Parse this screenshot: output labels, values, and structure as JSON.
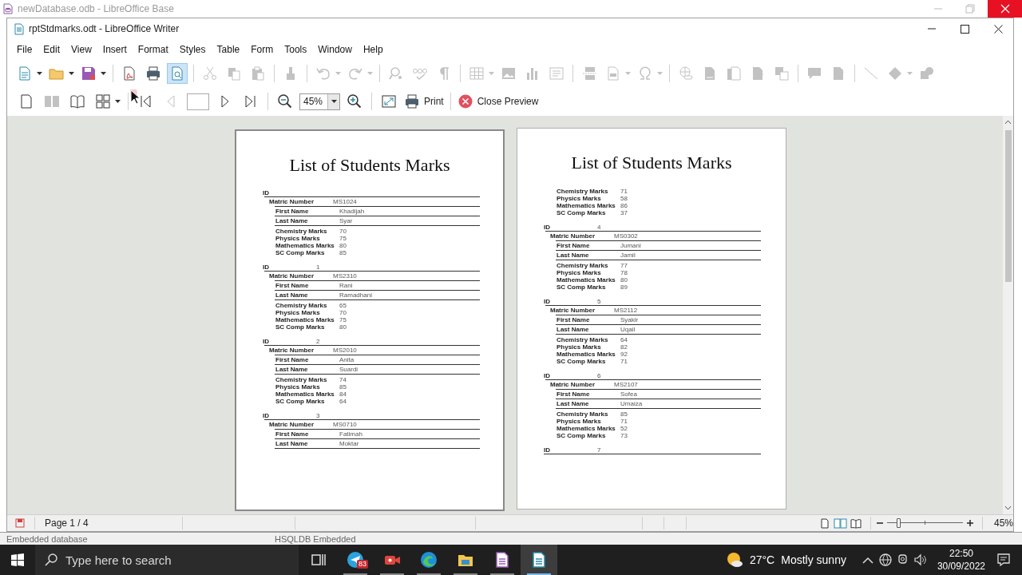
{
  "base_window": {
    "title": "newDatabase.odb - LibreOffice Base",
    "status_left": "Embedded database",
    "status_right": "HSQLDB Embedded"
  },
  "writer_window": {
    "title": "rptStdmarks.odt - LibreOffice Writer"
  },
  "menu": [
    "File",
    "Edit",
    "View",
    "Insert",
    "Format",
    "Styles",
    "Table",
    "Form",
    "Tools",
    "Window",
    "Help"
  ],
  "standard_toolbar": [
    {
      "kind": "new",
      "disabled": false,
      "dropdown": true,
      "selected": false
    },
    {
      "kind": "open",
      "disabled": false,
      "dropdown": true,
      "selected": false
    },
    {
      "kind": "save",
      "disabled": false,
      "dropdown": true,
      "selected": false
    },
    {
      "kind": "separator"
    },
    {
      "kind": "pdf",
      "disabled": false,
      "dropdown": false,
      "selected": false
    },
    {
      "kind": "print",
      "disabled": false,
      "dropdown": false,
      "selected": false
    },
    {
      "kind": "preview",
      "disabled": false,
      "dropdown": false,
      "selected": true
    },
    {
      "kind": "separator"
    },
    {
      "kind": "cut",
      "disabled": true,
      "dropdown": false,
      "selected": false
    },
    {
      "kind": "copy",
      "disabled": true,
      "dropdown": false,
      "selected": false
    },
    {
      "kind": "paste",
      "disabled": true,
      "dropdown": false,
      "selected": false
    },
    {
      "kind": "separator"
    },
    {
      "kind": "clone",
      "disabled": true,
      "dropdown": false,
      "selected": false
    },
    {
      "kind": "separator"
    },
    {
      "kind": "undo",
      "disabled": true,
      "dropdown": true,
      "selected": false
    },
    {
      "kind": "redo",
      "disabled": true,
      "dropdown": true,
      "selected": false
    },
    {
      "kind": "separator"
    },
    {
      "kind": "find",
      "disabled": true,
      "dropdown": false,
      "selected": false
    },
    {
      "kind": "spell",
      "disabled": true,
      "dropdown": false,
      "selected": false
    },
    {
      "kind": "pilcrow",
      "disabled": true,
      "dropdown": false,
      "selected": false
    },
    {
      "kind": "separator"
    },
    {
      "kind": "table",
      "disabled": true,
      "dropdown": true,
      "selected": false
    },
    {
      "kind": "image",
      "disabled": true,
      "dropdown": false,
      "selected": false
    },
    {
      "kind": "chart",
      "disabled": true,
      "dropdown": false,
      "selected": false
    },
    {
      "kind": "textbox",
      "disabled": true,
      "dropdown": false,
      "selected": false
    },
    {
      "kind": "separator"
    },
    {
      "kind": "pagebreak",
      "disabled": true,
      "dropdown": false,
      "selected": false
    },
    {
      "kind": "field",
      "disabled": true,
      "dropdown": true,
      "selected": false
    },
    {
      "kind": "omega",
      "disabled": true,
      "dropdown": true,
      "selected": false
    },
    {
      "kind": "separator"
    },
    {
      "kind": "hyperlink",
      "disabled": true,
      "dropdown": false,
      "selected": false
    },
    {
      "kind": "footnote",
      "disabled": true,
      "dropdown": false,
      "selected": false
    },
    {
      "kind": "endnote",
      "disabled": true,
      "dropdown": false,
      "selected": false
    },
    {
      "kind": "bookmark",
      "disabled": true,
      "dropdown": false,
      "selected": false
    },
    {
      "kind": "crossref",
      "disabled": true,
      "dropdown": false,
      "selected": false
    },
    {
      "kind": "separator"
    },
    {
      "kind": "comment",
      "disabled": true,
      "dropdown": false,
      "selected": false
    },
    {
      "kind": "track",
      "disabled": true,
      "dropdown": false,
      "selected": false
    },
    {
      "kind": "separator"
    },
    {
      "kind": "line",
      "disabled": true,
      "dropdown": false,
      "selected": false
    },
    {
      "kind": "diamond",
      "disabled": true,
      "dropdown": true,
      "selected": false
    },
    {
      "kind": "shapes",
      "disabled": true,
      "dropdown": false,
      "selected": false
    }
  ],
  "preview_toolbar": [
    {
      "kind": "single_page",
      "disabled": false,
      "dropdown": false
    },
    {
      "kind": "two_pages",
      "disabled": true,
      "dropdown": false
    },
    {
      "kind": "book",
      "disabled": false,
      "dropdown": false
    },
    {
      "kind": "multi",
      "disabled": false,
      "dropdown": true
    },
    {
      "kind": "separator"
    },
    {
      "kind": "first_page",
      "disabled": false,
      "dropdown": false
    },
    {
      "kind": "previous",
      "disabled": true,
      "dropdown": false
    },
    {
      "kind": "page_field",
      "disabled": false,
      "dropdown": false
    },
    {
      "kind": "next",
      "disabled": false,
      "dropdown": false
    },
    {
      "kind": "last_page",
      "disabled": false,
      "dropdown": false
    },
    {
      "kind": "separator"
    },
    {
      "kind": "zoom_out",
      "disabled": false,
      "dropdown": false
    },
    {
      "kind": "zoom_box",
      "disabled": false,
      "dropdown": true,
      "value": "45%"
    },
    {
      "kind": "zoom_in",
      "disabled": false,
      "dropdown": false
    },
    {
      "kind": "separator"
    },
    {
      "kind": "fullscreen",
      "disabled": false,
      "dropdown": false
    },
    {
      "kind": "print",
      "disabled": false,
      "dropdown": false,
      "label": "Print"
    },
    {
      "kind": "separator"
    },
    {
      "kind": "close_preview",
      "disabled": false,
      "dropdown": false,
      "label": "Close Preview"
    }
  ],
  "pages": [
    {
      "title": "List of Students Marks",
      "records": [
        {
          "id_label": "ID",
          "matric_label": "Matric Number",
          "matric": "MS1024",
          "first_label": "First Name",
          "first": "Khadijah",
          "last_label": "Last Name",
          "last": "Syar",
          "marks": [
            {
              "label": "Chemistry Marks",
              "value": "70"
            },
            {
              "label": "Physics Marks",
              "value": "75"
            },
            {
              "label": "Mathematics Marks",
              "value": "80"
            },
            {
              "label": "SC Comp Marks",
              "value": "85"
            }
          ]
        },
        {
          "id_label": "ID",
          "id": "1",
          "matric_label": "Matric Number",
          "matric": "MS2310",
          "first_label": "First Name",
          "first": "Rani",
          "last_label": "Last Name",
          "last": "Ramadhani",
          "marks": [
            {
              "label": "Chemistry Marks",
              "value": "65"
            },
            {
              "label": "Physics Marks",
              "value": "70"
            },
            {
              "label": "Mathematics Marks",
              "value": "75"
            },
            {
              "label": "SC Comp Marks",
              "value": "80"
            }
          ]
        },
        {
          "id_label": "ID",
          "id": "2",
          "matric_label": "Matric Number",
          "matric": "MS2010",
          "first_label": "First Name",
          "first": "Anita",
          "last_label": "Last Name",
          "last": "Suardi",
          "marks": [
            {
              "label": "Chemistry Marks",
              "value": "74"
            },
            {
              "label": "Physics Marks",
              "value": "85"
            },
            {
              "label": "Mathematics Marks",
              "value": "84"
            },
            {
              "label": "SC Comp Marks",
              "value": "64"
            }
          ]
        },
        {
          "id_label": "ID",
          "id": "3",
          "matric_label": "Matric Number",
          "matric": "MS0710",
          "first_label": "First Name",
          "first": "Fatimah",
          "last_label": "Last Name",
          "last": "Moktar"
        }
      ]
    },
    {
      "title": "List of Students Marks",
      "records": [
        {
          "marks": [
            {
              "label": "Chemistry Marks",
              "value": "71"
            },
            {
              "label": "Physics Marks",
              "value": "58"
            },
            {
              "label": "Mathematics Marks",
              "value": "86"
            },
            {
              "label": "SC Comp Marks",
              "value": "37"
            }
          ]
        },
        {
          "id_label": "ID",
          "id": "4",
          "matric_label": "Matric Number",
          "matric": "MS0302",
          "first_label": "First Name",
          "first": "Jumani",
          "last_label": "Last Name",
          "last": "Jamil",
          "marks": [
            {
              "label": "Chemistry Marks",
              "value": "77"
            },
            {
              "label": "Physics Marks",
              "value": "78"
            },
            {
              "label": "Mathematics Marks",
              "value": "80"
            },
            {
              "label": "SC Comp Marks",
              "value": "89"
            }
          ]
        },
        {
          "id_label": "ID",
          "id": "5",
          "matric_label": "Matric Number",
          "matric": "MS2112",
          "first_label": "First Name",
          "first": "Syakir",
          "last_label": "Last Name",
          "last": "Uqail",
          "marks": [
            {
              "label": "Chemistry Marks",
              "value": "64"
            },
            {
              "label": "Physics Marks",
              "value": "82"
            },
            {
              "label": "Mathematics Marks",
              "value": "92"
            },
            {
              "label": "SC Comp Marks",
              "value": "71"
            }
          ]
        },
        {
          "id_label": "ID",
          "id": "6",
          "matric_label": "Matric Number",
          "matric": "MS2107",
          "first_label": "First Name",
          "first": "Sofea",
          "last_label": "Last Name",
          "last": "Umaiza",
          "marks": [
            {
              "label": "Chemistry Marks",
              "value": "85"
            },
            {
              "label": "Physics Marks",
              "value": "71"
            },
            {
              "label": "Mathematics Marks",
              "value": "52"
            },
            {
              "label": "SC Comp Marks",
              "value": "73"
            }
          ]
        },
        {
          "id_label": "ID",
          "id": "7",
          "rule": true
        }
      ]
    }
  ],
  "status_bar": {
    "page": "Page 1 / 4",
    "zoom": "45%",
    "zoom_slider": {
      "level": 0.15
    }
  },
  "taskbar": {
    "search_placeholder": "Type here to search",
    "apps": [
      {
        "kind": "task_view",
        "running": false,
        "active": false
      },
      {
        "kind": "telegram",
        "running": true,
        "active": false,
        "badge": "83"
      },
      {
        "kind": "video",
        "running": true,
        "active": false
      },
      {
        "kind": "edge",
        "running": true,
        "active": false
      },
      {
        "kind": "explorer",
        "running": true,
        "active": false
      },
      {
        "kind": "base",
        "running": true,
        "active": false
      },
      {
        "kind": "writer",
        "running": true,
        "active": true
      }
    ],
    "weather": {
      "temperature": "27°C",
      "condition": "Mostly sunny"
    },
    "clock": {
      "time": "22:50",
      "date": "30/09/2022"
    }
  }
}
